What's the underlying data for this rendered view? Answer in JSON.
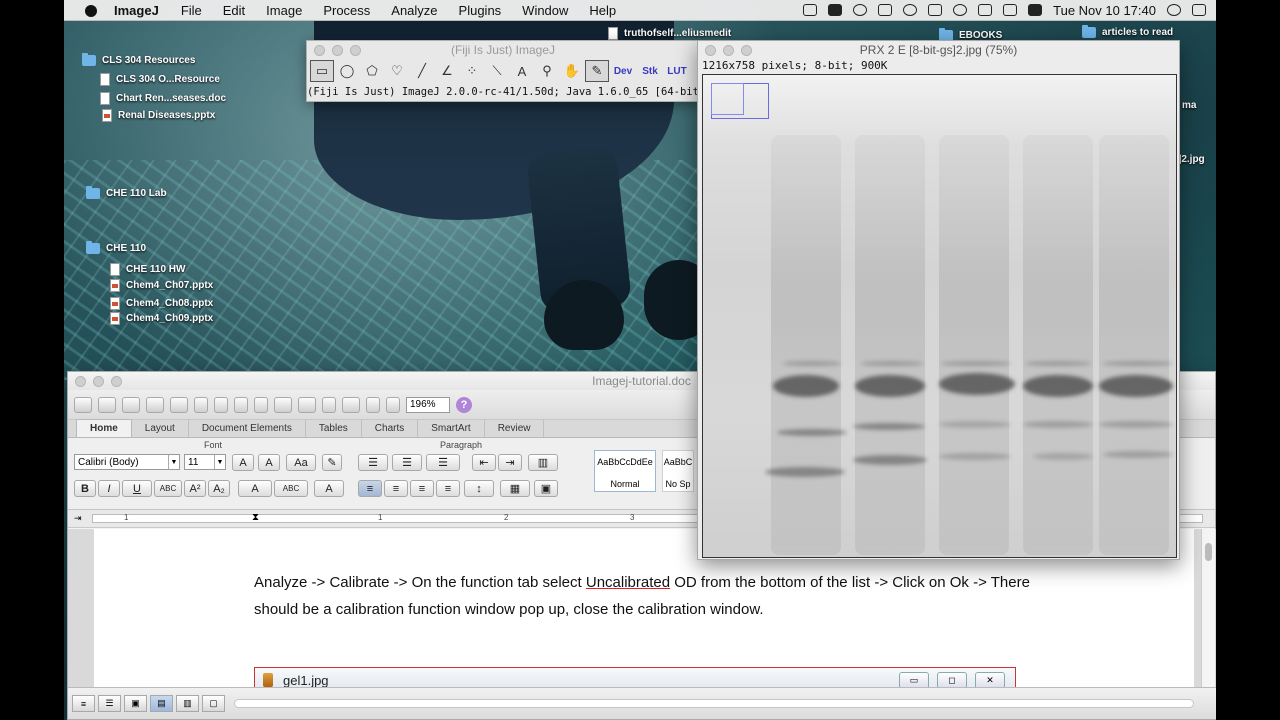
{
  "menubar": {
    "app_name": "ImageJ",
    "items": [
      "File",
      "Edit",
      "Image",
      "Process",
      "Analyze",
      "Plugins",
      "Window",
      "Help"
    ],
    "clock": "Tue Nov 10  17:40"
  },
  "desktop": {
    "items": [
      {
        "label": "CLS 304 Resources",
        "type": "folder"
      },
      {
        "label": "CLS 304 O...Resource",
        "type": "doc"
      },
      {
        "label": "Chart Ren...seases.doc",
        "type": "doc"
      },
      {
        "label": "Renal Diseases.pptx",
        "type": "pptx"
      },
      {
        "label": "CHE 110 Lab",
        "type": "folder"
      },
      {
        "label": "CHE 110",
        "type": "folder"
      },
      {
        "label": "CHE 110 HW",
        "type": "doc"
      },
      {
        "label": "Chem4_Ch07.pptx",
        "type": "pptx"
      },
      {
        "label": "Chem4_Ch08.pptx",
        "type": "pptx"
      },
      {
        "label": "Chem4_Ch09.pptx",
        "type": "pptx"
      },
      {
        "label": "truthofself...eliusmedit",
        "type": "doc"
      },
      {
        "label": "articles to read",
        "type": "folder"
      },
      {
        "label": "EBOOKS",
        "type": "folder"
      }
    ],
    "partial_labels": [
      "ma",
      "]2.jpg"
    ]
  },
  "imagej": {
    "title": "(Fiji Is Just) ImageJ",
    "tool_labels": [
      "Dev",
      "Stk",
      "LUT"
    ],
    "status": "(Fiji Is Just) ImageJ 2.0.0-rc-41/1.50d; Java 1.6.0_65 [64-bit];"
  },
  "image_window": {
    "title": "PRX 2 E [8-bit-gs]2.jpg (75%)",
    "info": "1216x758 pixels; 8-bit; 900K"
  },
  "word": {
    "title": "Imagej-tutorial.doc",
    "zoom": "196%",
    "tabs": [
      "Home",
      "Layout",
      "Document Elements",
      "Tables",
      "Charts",
      "SmartArt",
      "Review"
    ],
    "groups": {
      "font": "Font",
      "paragraph": "Paragraph"
    },
    "font_name": "Calibri (Body)",
    "font_size": "11",
    "styles": [
      {
        "preview": "AaBbCcDdEe",
        "name": "Normal"
      },
      {
        "preview": "AaBbC",
        "name": "No Sp"
      }
    ],
    "ruler_numbers": [
      "1",
      "1",
      "2",
      "3"
    ],
    "paragraph": {
      "part1": "Analyze -> Calibrate -> On the function tab select ",
      "underlined": "Uncalibrated",
      "part2": " OD from the bottom of the list -> Click on Ok -> There should be a calibration function window pop up, close the calibration window."
    },
    "embedded_window": {
      "title": "gel1.jpg"
    }
  },
  "colors": {
    "accent_folder": "#6fb5e8",
    "roi": "#6b6be0",
    "help_button": "#b085d8",
    "embed_border": "#cc3333"
  }
}
